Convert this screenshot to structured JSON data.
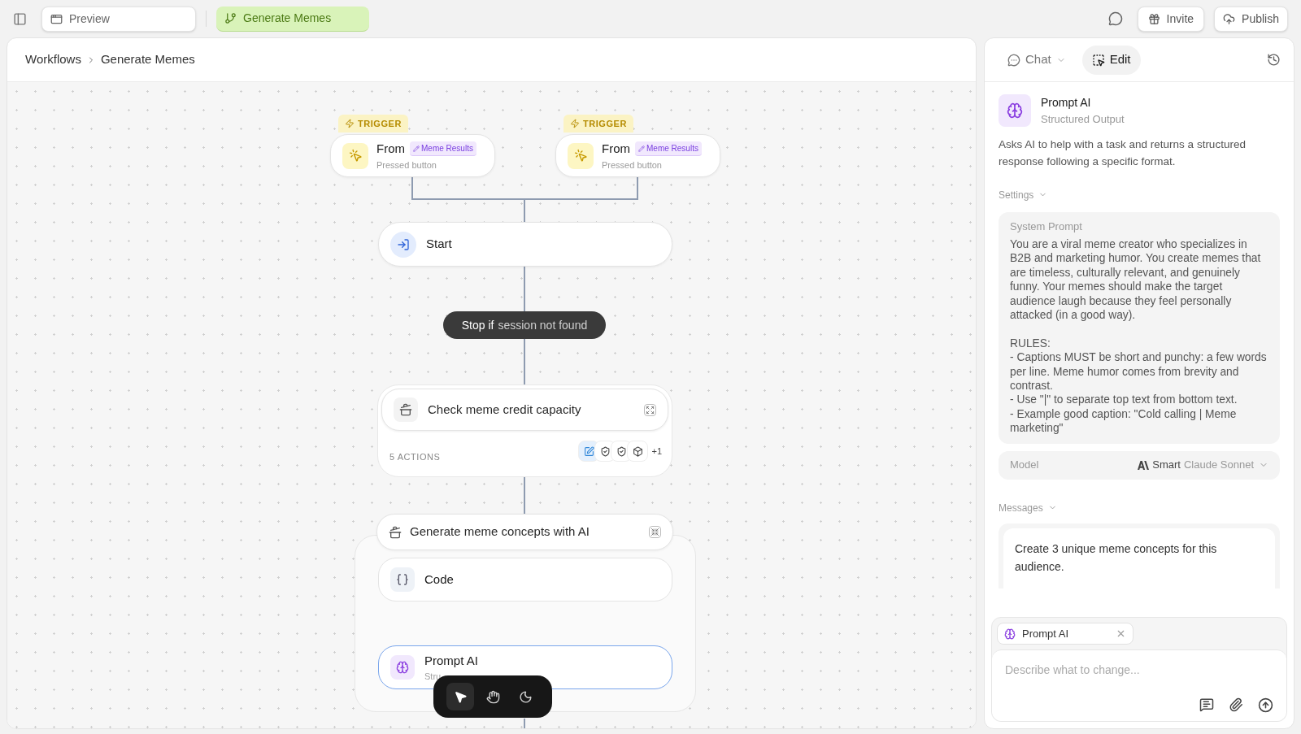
{
  "topbar": {
    "preview": "Preview",
    "workflow_tab": "Generate Memes",
    "invite": "Invite",
    "publish": "Publish"
  },
  "breadcrumb": [
    "Workflows",
    "Generate Memes"
  ],
  "canvas": {
    "triggers": [
      {
        "label": "TRIGGER",
        "title": "From",
        "tag": "Meme Results",
        "subtitle": "Pressed button"
      },
      {
        "label": "TRIGGER",
        "title": "From",
        "tag": "Meme Results",
        "subtitle": "Pressed button"
      }
    ],
    "start": {
      "title": "Start"
    },
    "condition": {
      "keyword": "Stop if",
      "text": "session not found"
    },
    "check": {
      "title": "Check meme credit capacity",
      "actions_count": "5 ACTIONS",
      "more": "+1",
      "actions": [
        {
          "kind": "edit"
        },
        {
          "kind": "shield"
        },
        {
          "kind": "shield"
        },
        {
          "kind": "box"
        }
      ]
    },
    "group": {
      "title": "Generate meme concepts with AI",
      "nodes": [
        {
          "kind": "code",
          "title": "Code",
          "selected": false
        },
        {
          "kind": "prompt",
          "title": "Prompt AI",
          "subtitle": "Stru",
          "selected": true
        }
      ]
    },
    "tools": [
      {
        "kind": "pointer",
        "selected": true
      },
      {
        "kind": "hand",
        "selected": false
      },
      {
        "kind": "moon",
        "selected": false
      }
    ]
  },
  "panel": {
    "tabs": [
      {
        "kind": "chat",
        "label": "Chat",
        "selected": false
      },
      {
        "kind": "edit",
        "label": "Edit",
        "selected": true
      }
    ],
    "node": {
      "title": "Prompt AI",
      "subtitle": "Structured Output",
      "description": "Asks AI to help with a task and returns a structured response following a specific format."
    },
    "settings_label": "Settings",
    "system_prompt": {
      "label": "System Prompt",
      "text": "You are a viral meme creator who specializes in B2B and marketing humor. You create memes that are timeless, culturally relevant, and genuinely funny. Your memes should make the target audience laugh because they feel personally attacked (in a good way).\n\nRULES:\n- Captions MUST be short and punchy: a few words per line. Meme humor comes from brevity and contrast.\n- Use \"|\" to separate top text from bottom text.\n- Example good caption: \"Cold calling | Meme marketing\""
    },
    "model": {
      "label": "Model",
      "tier": "Smart",
      "name": "Claude Sonnet"
    },
    "messages_label": "Messages",
    "message": "Create 3 unique meme concepts for this audience.",
    "composer": {
      "chip": "Prompt AI",
      "placeholder": "Describe what to change..."
    }
  }
}
